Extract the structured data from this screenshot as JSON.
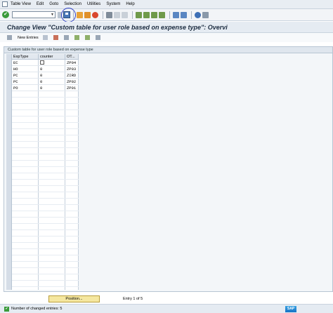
{
  "menu": [
    "Table View",
    "Edit",
    "Goto",
    "Selection",
    "Utilities",
    "System",
    "Help"
  ],
  "title": "Change View \"Custom table for user role based on expense type\": Overvi",
  "app_toolbar": {
    "new_entries_label": "New Entries"
  },
  "panel": {
    "header": "Custom table for user role based on expense type"
  },
  "table": {
    "columns": [
      "ExpType",
      "counter",
      "OT..."
    ],
    "rows": [
      {
        "exptype": "EC",
        "counter": "",
        "ot": "ZP04"
      },
      {
        "exptype": "HO",
        "counter": "0",
        "ot": "ZP03"
      },
      {
        "exptype": "PC",
        "counter": "0",
        "ot": "ZIRD"
      },
      {
        "exptype": "PC",
        "counter": "0",
        "ot": "ZP02"
      },
      {
        "exptype": "PO",
        "counter": "0",
        "ot": "ZP01"
      }
    ]
  },
  "position_label": "Position...",
  "entry_info": "Entry 1 of 5",
  "status": {
    "message": "Number of changed entries: 5"
  },
  "logo_text": "SAP"
}
